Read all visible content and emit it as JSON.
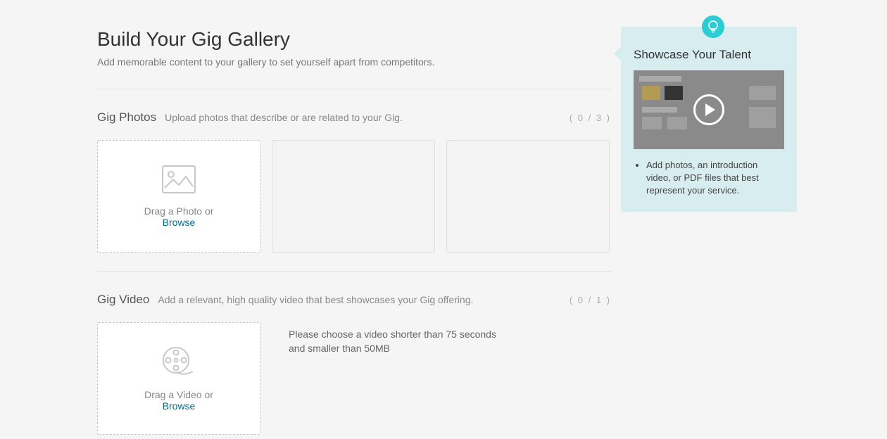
{
  "page": {
    "title": "Build Your Gig Gallery",
    "subtitle": "Add memorable content to your gallery to set yourself apart from competitors."
  },
  "photos": {
    "title": "Gig Photos",
    "desc": "Upload photos that describe or are related to your Gig.",
    "count": "( 0 / 3 )",
    "drag_text": "Drag a Photo or",
    "browse": "Browse"
  },
  "video": {
    "title": "Gig Video",
    "desc": "Add a relevant, high quality video that best showcases your Gig offering.",
    "count": "( 0 / 1 )",
    "drag_text": "Drag a Video or",
    "browse": "Browse",
    "hint": "Please choose a video shorter than 75 seconds and smaller than 50MB"
  },
  "sidebar": {
    "tip_title": "Showcase Your Talent",
    "tip_item": "Add photos, an introduction video, or PDF files that best represent your service."
  }
}
